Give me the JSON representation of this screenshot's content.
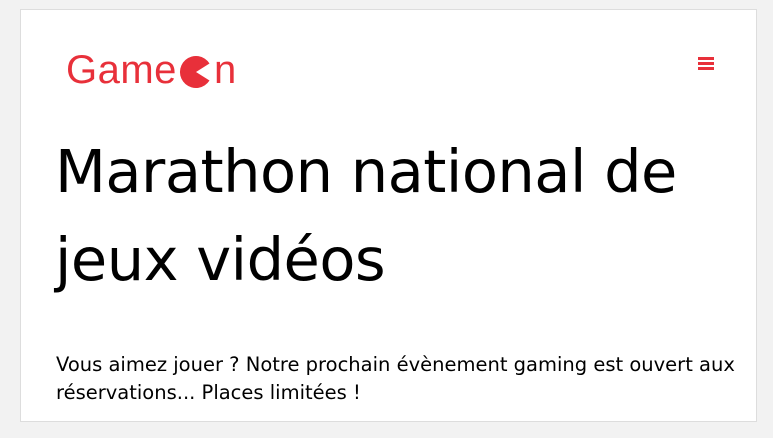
{
  "header": {
    "logo": {
      "text_before": "Game",
      "icon": "pacman-icon",
      "text_after": "n",
      "color": "#e8303a"
    },
    "menu_icon": "hamburger-menu-icon",
    "menu_color": "#e8303a"
  },
  "hero": {
    "title": "Marathon national de jeux vidéos",
    "description": "Vous aimez jouer ? Notre prochain évènement gaming est ouvert aux réservations... Places limitées !"
  }
}
